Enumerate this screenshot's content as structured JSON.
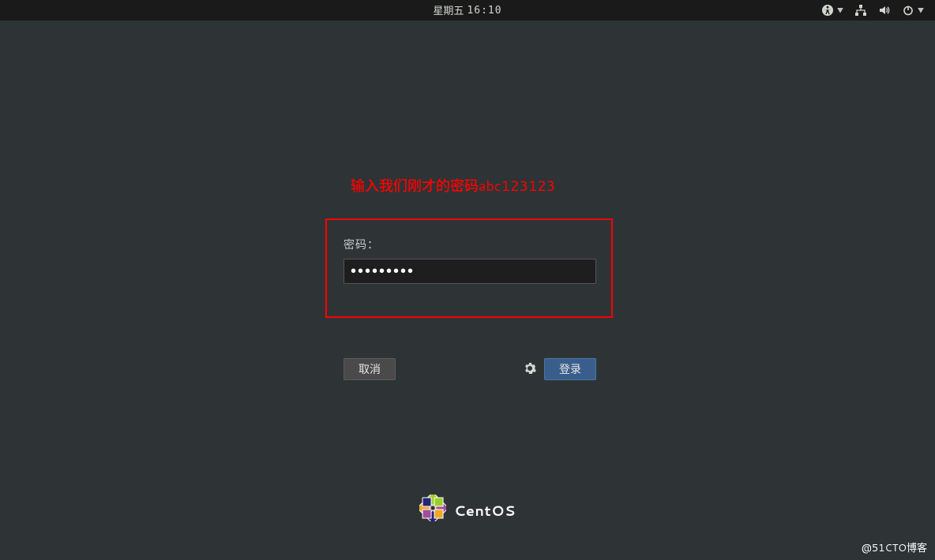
{
  "topbar": {
    "day_label": "星期五",
    "time": "16:10"
  },
  "annotation": {
    "text": "输入我们刚才的密码abc123123"
  },
  "login": {
    "password_label": "密码：",
    "password_value": "●●●●●●●●●",
    "cancel_label": "取消",
    "login_label": "登录"
  },
  "brand": {
    "name": "CentOS"
  },
  "icons": {
    "accessibility": "accessibility-icon",
    "network": "network-icon",
    "volume": "volume-icon",
    "power": "power-icon",
    "gear": "gear-icon",
    "centos": "centos-logo"
  },
  "watermark": "@51CTO博客",
  "colors": {
    "bg": "#2e3436",
    "annotation_red": "#ff0000",
    "button_primary": "#3a5e8c"
  }
}
